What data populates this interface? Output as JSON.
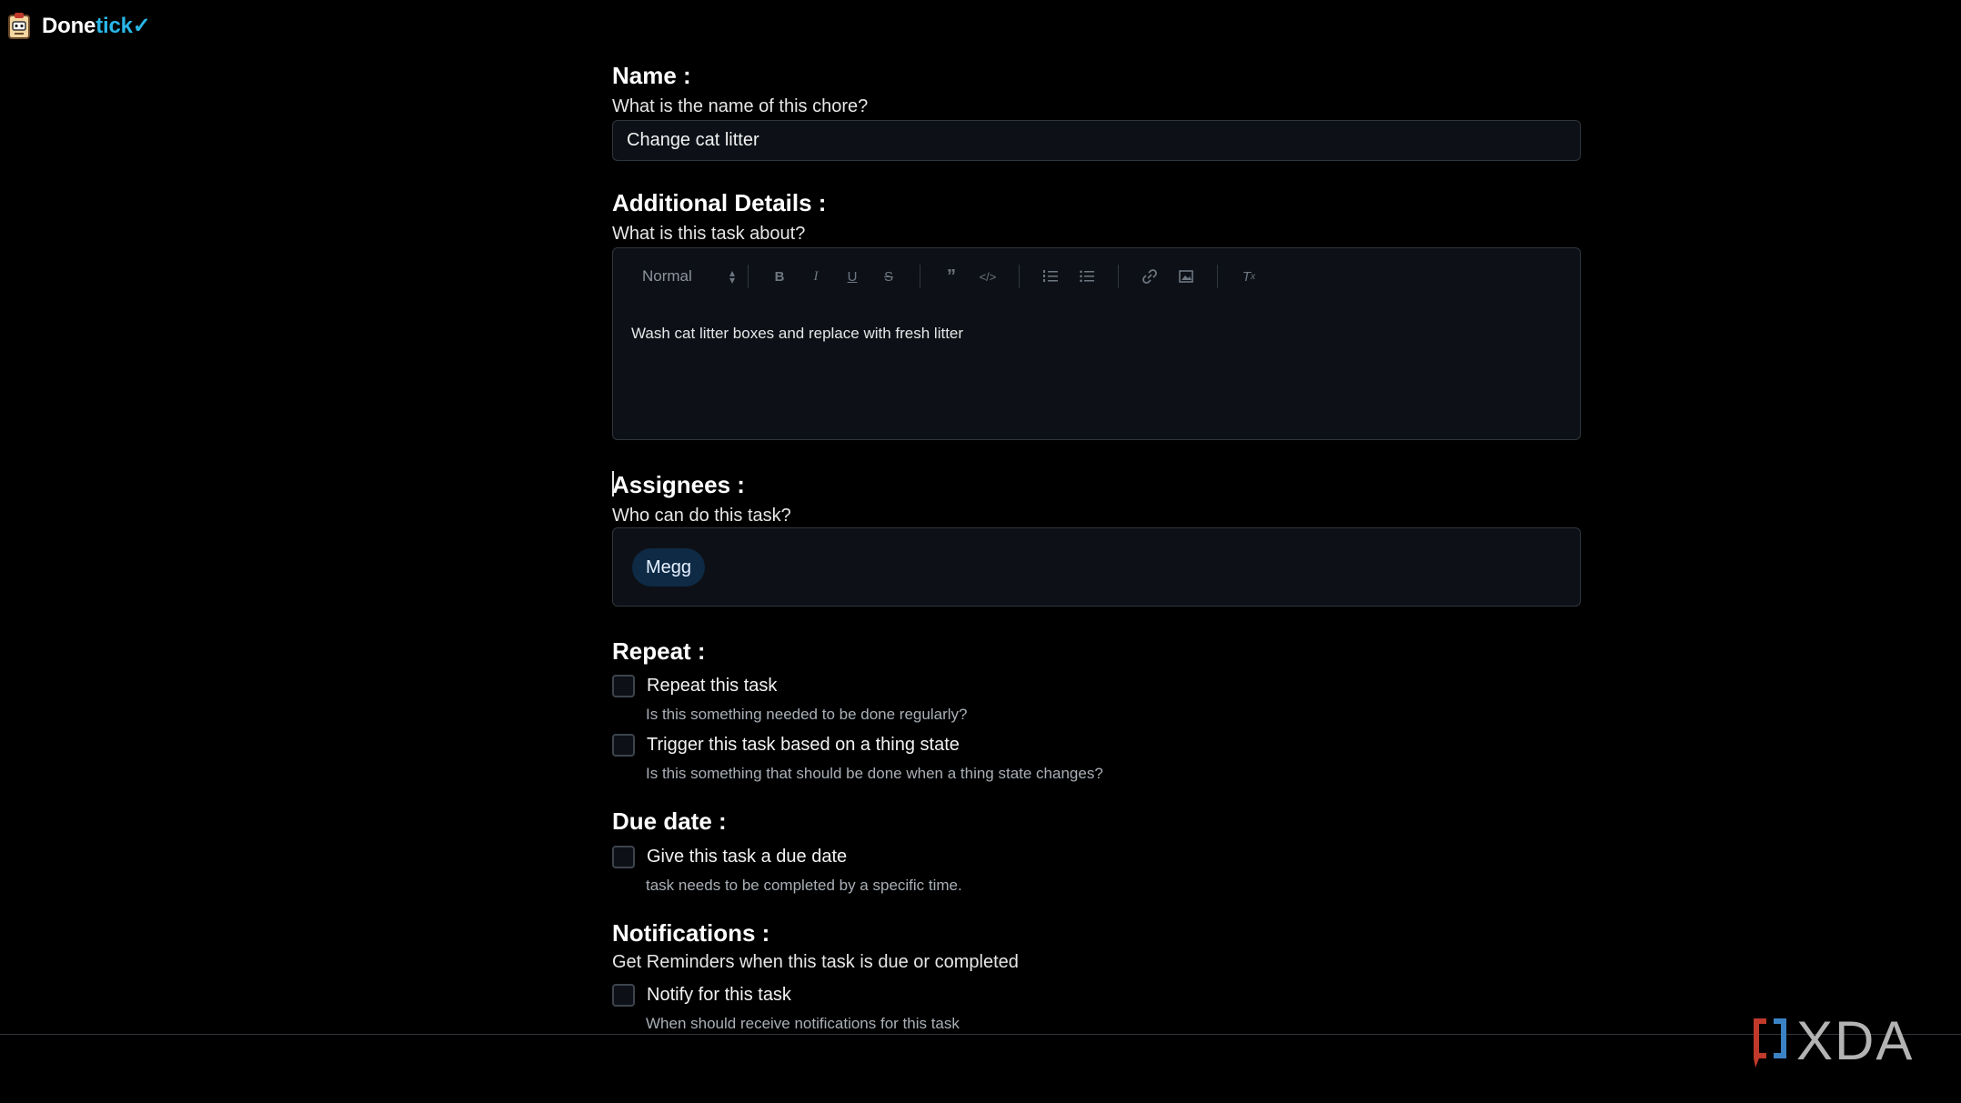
{
  "app": {
    "brand_part1": "Done",
    "brand_part2": "tick",
    "brand_check": "✓",
    "logo_icon": "robot-clipboard-icon"
  },
  "name_section": {
    "title": "Name :",
    "subtitle": "What is the name of this chore?",
    "value": "Change cat litter"
  },
  "details_section": {
    "title": "Additional Details :",
    "subtitle": "What is this task about?",
    "toolbar": {
      "format_select": "Normal",
      "buttons": [
        "bold-icon",
        "italic-icon",
        "underline-icon",
        "strike-icon",
        "quote-icon",
        "code-icon",
        "ordered-list-icon",
        "bullet-list-icon",
        "link-icon",
        "image-icon",
        "clear-format-icon"
      ]
    },
    "body": "Wash cat litter boxes and replace with fresh litter"
  },
  "assignees_section": {
    "title": "Assignees :",
    "subtitle": "Who can do this task?",
    "assignees": [
      "Megg"
    ]
  },
  "repeat_section": {
    "title": "Repeat :",
    "options": [
      {
        "label": "Repeat this task",
        "help": "Is this something needed to be done regularly?",
        "checked": false
      },
      {
        "label": "Trigger this task based on a thing state",
        "help": "Is this something that should be done when a thing state changes?",
        "checked": false
      }
    ]
  },
  "due_section": {
    "title": "Due date :",
    "option": {
      "label": "Give this task a due date",
      "help": "task needs to be completed by a specific time.",
      "checked": false
    }
  },
  "notifications_section": {
    "title": "Notifications :",
    "subtitle": "Get Reminders when this task is due or completed",
    "option": {
      "label": "Notify for this task",
      "help": "When should receive notifications for this task",
      "checked": false
    }
  },
  "watermark": {
    "text": "XDA"
  },
  "colors": {
    "accent": "#29b6e8",
    "background": "#000000",
    "field": "#0d1117",
    "chip": "#0e2a45"
  }
}
